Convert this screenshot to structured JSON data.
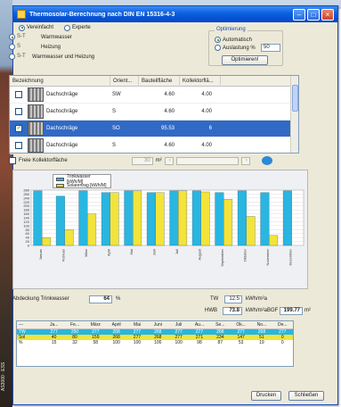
{
  "window": {
    "title": "Thermosolar-Berechnung nach DIN EN 15316-4-3",
    "minimize_icon": "minimize-icon",
    "maximize_icon": "maximize-icon",
    "close_icon": "close-icon"
  },
  "side_caption": "AS3000 · ESS",
  "modes": [
    {
      "label": "Vereinfacht",
      "selected": true
    },
    {
      "label": "Experte",
      "selected": false
    }
  ],
  "usage_options": [
    {
      "label": "Warmwasser",
      "symbol": "S-T",
      "selected": true
    },
    {
      "label": "Heizung",
      "symbol": "S",
      "selected": false
    },
    {
      "label": "Warmwasser und Heizung",
      "symbol": "S-T",
      "selected": false
    }
  ],
  "optimization": {
    "legend": "Optimierung",
    "auto_label": "Automatisch",
    "coverage_label": "Auslastung %",
    "coverage_value": "50",
    "button_label": "Optimieren!"
  },
  "surfaces": {
    "headers": [
      "Bezeichnung",
      "Orient...",
      "Bauteilfläche",
      "Kollektorflä..."
    ],
    "rows": [
      {
        "checked": false,
        "name": "Dachschräge",
        "orient": "SW",
        "area": "4.60",
        "collector": "4.00",
        "selected": false
      },
      {
        "checked": false,
        "name": "Dachschräge",
        "orient": "S",
        "area": "4.60",
        "collector": "4.00",
        "selected": false
      },
      {
        "checked": true,
        "name": "Dachschräge",
        "orient": "SO",
        "area": "95.53",
        "collector": "6",
        "selected": true
      },
      {
        "checked": false,
        "name": "Dachschräge",
        "orient": "S",
        "area": "4.60",
        "collector": "4.00",
        "selected": false
      }
    ]
  },
  "filter": {
    "free_collector_label": "Freie Kollektorfläche",
    "unit": "m²"
  },
  "chart_data": {
    "type": "bar",
    "categories": [
      "Januar",
      "Februar",
      "März",
      "April",
      "Mai",
      "Juni",
      "Juli",
      "August",
      "September",
      "Oktober",
      "November",
      "Dezember"
    ],
    "series": [
      {
        "name": "Trinkwasser [kWh/M]",
        "color": "#29b6e0",
        "values": [
          277,
          250,
          277,
          268,
          277,
          268,
          277,
          277,
          268,
          277,
          268,
          277
        ]
      },
      {
        "name": "Solarertrag [kWh/M]",
        "color": "#f3e33a",
        "values": [
          40,
          80,
          159,
          268,
          277,
          268,
          277,
          271,
          234,
          147,
          51,
          0
        ]
      }
    ],
    "ylim": [
      0,
      280
    ],
    "yticks": [
      0,
      20,
      40,
      60,
      80,
      100,
      120,
      140,
      160,
      180,
      200,
      220,
      240,
      260,
      280
    ],
    "grid": true,
    "legend_position": "top-left"
  },
  "results": {
    "coverage_label": "Abdeckung Trinkwasser",
    "coverage_value": "64",
    "coverage_unit": "%",
    "tw_label": "TW",
    "tw_value": "12.5",
    "tw_unit": "kWh/m²a",
    "hwb_label": "HWB",
    "hwb_value": "73.8",
    "hwb_unit": "kWh/m²a",
    "bgf_label": "BGF",
    "bgf_value": "199.77",
    "bgf_unit": "m²"
  },
  "monthly_table": {
    "headers": [
      "---",
      "Ja...",
      "Fe...",
      "März",
      "April",
      "Mai",
      "Juni",
      "Juli",
      "Au...",
      "Se...",
      "Ok...",
      "No...",
      "De..."
    ],
    "rows": [
      {
        "label": "TW",
        "values": [
          "277",
          "250",
          "277",
          "268",
          "277",
          "268",
          "277",
          "277",
          "268",
          "277",
          "268",
          "277"
        ],
        "style": "tw"
      },
      {
        "label": "Sol",
        "values": [
          "40",
          "80",
          "159",
          "268",
          "277",
          "268",
          "277",
          "271",
          "234",
          "147",
          "51",
          "0"
        ],
        "style": "sol"
      },
      {
        "label": "%",
        "values": [
          "15",
          "32",
          "58",
          "100",
          "100",
          "100",
          "100",
          "98",
          "87",
          "53",
          "19",
          "0"
        ],
        "style": "pct"
      }
    ]
  },
  "buttons": {
    "print": "Drucken",
    "close": "Schließen"
  }
}
